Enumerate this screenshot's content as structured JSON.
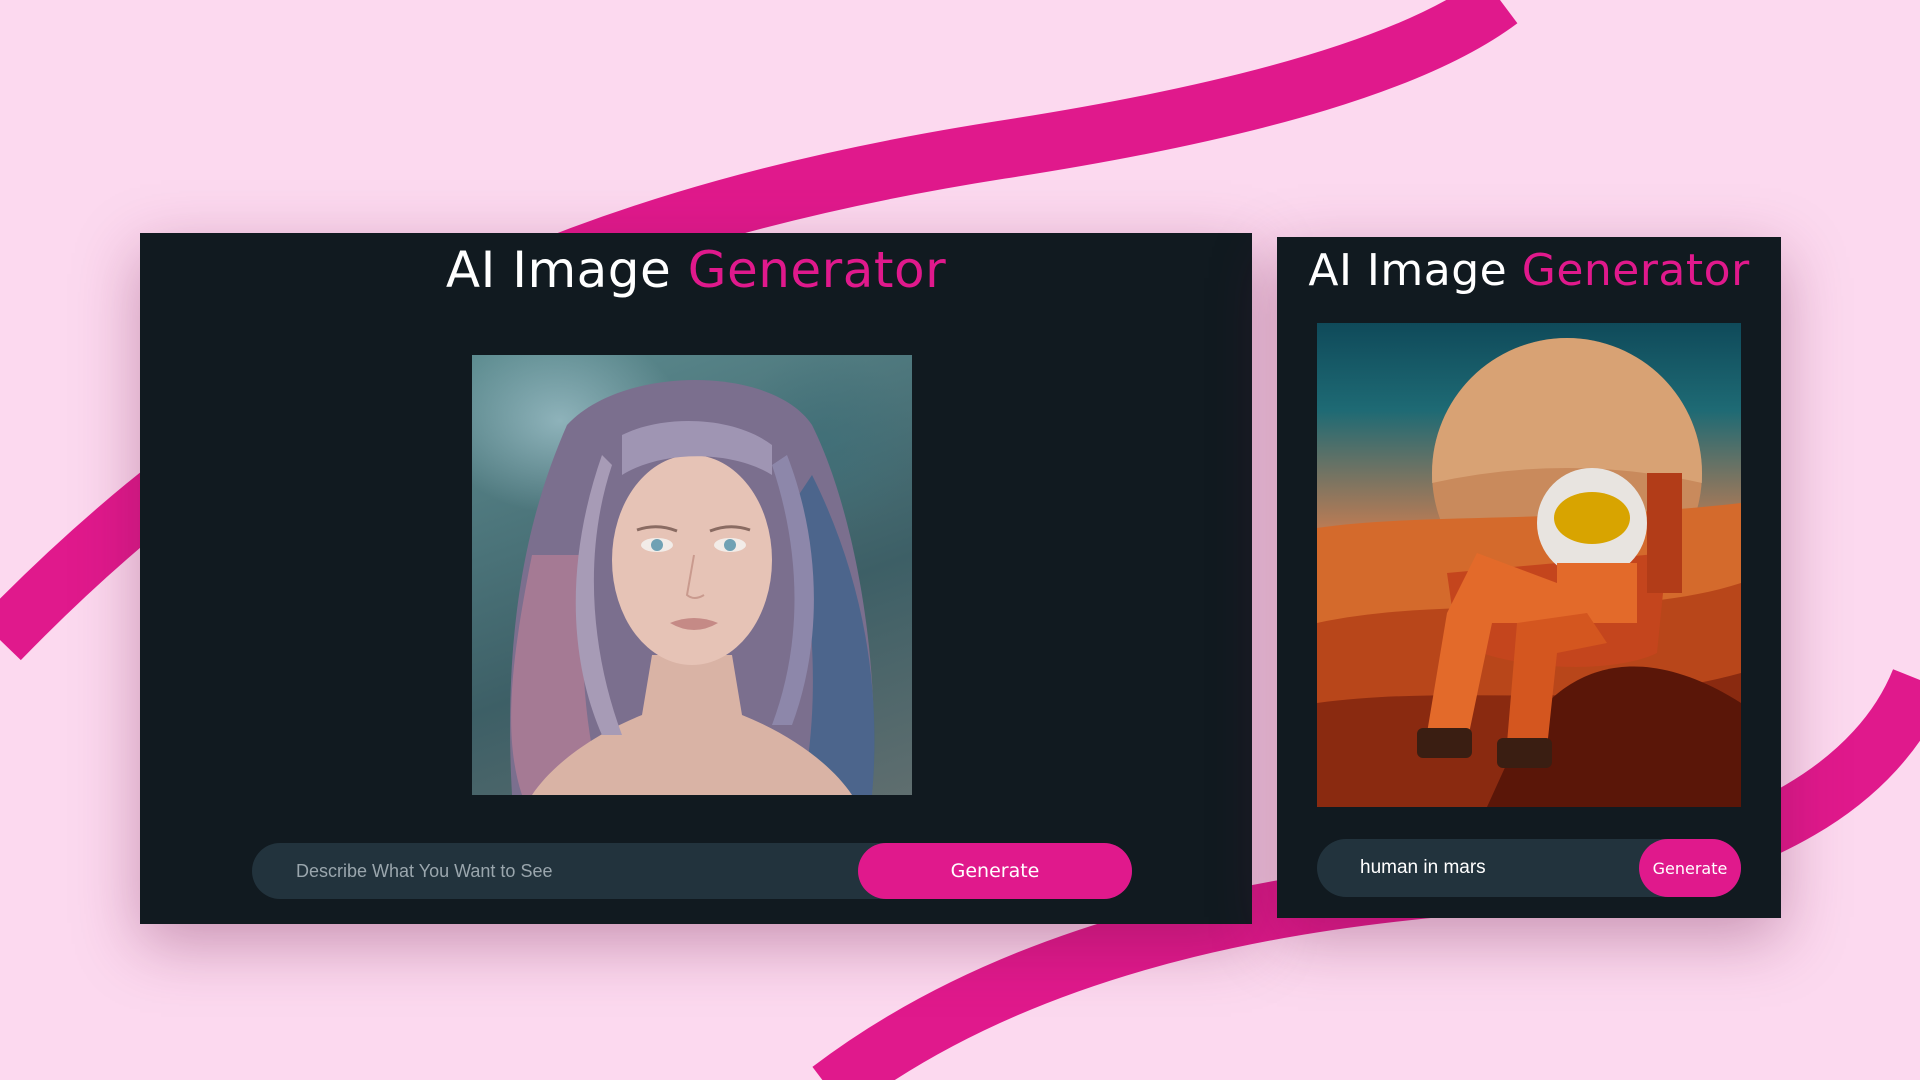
{
  "colors": {
    "background": "#fcd9ef",
    "ribbon": "#e0198c",
    "card": "#111a20",
    "input": "#22333d",
    "accent": "#e0198c",
    "title_text": "#ffffff",
    "placeholder": "#9aa6ad"
  },
  "large_app": {
    "title_main": "AI Image",
    "title_accent": "Generator",
    "image_subject": "portrait-of-woman-with-wavy-pastel-hair",
    "prompt_value": "",
    "prompt_placeholder": "Describe What You Want to See",
    "generate_label": "Generate"
  },
  "small_app": {
    "title_main": "AI Image",
    "title_accent": "Generator",
    "image_subject": "astronaut-on-chair-in-mars-desert",
    "prompt_value": "human in mars",
    "prompt_placeholder": "",
    "generate_label": "Generate"
  }
}
